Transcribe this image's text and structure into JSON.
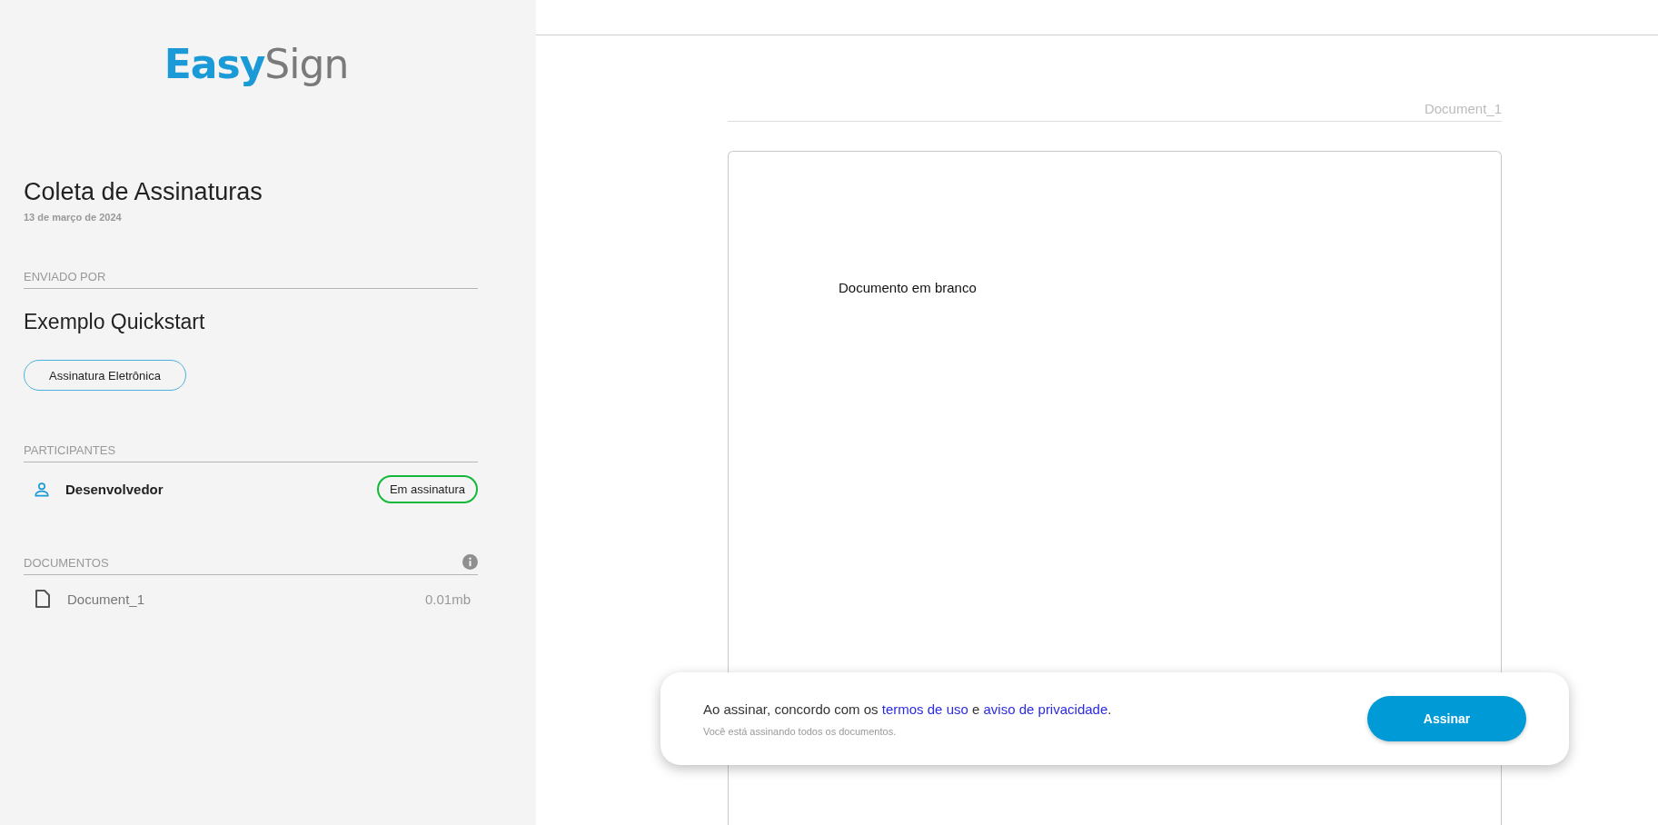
{
  "logo": "**Easy**Sign",
  "envelope": {
    "title": "Coleta de Assinaturas",
    "date": "13 de março de 2024"
  },
  "sender": {
    "heading": "ENVIADO POR",
    "name": "Exemplo Quickstart",
    "signature_type": "Assinatura Eletrônica"
  },
  "participants": {
    "heading": "PARTICIPANTES",
    "items": [
      {
        "name": "Desenvolvedor",
        "status": "Em assinatura"
      }
    ]
  },
  "documents": {
    "heading": "DOCUMENTOS",
    "items": [
      {
        "name": "Document_1",
        "size": "0.01mb"
      }
    ]
  },
  "viewer": {
    "document_title": "Document_1",
    "page_text": "Documento em branco"
  },
  "consent": {
    "segments": [
      {
        "kind": "text",
        "text": "Ao assinar, concordo com os "
      },
      {
        "kind": "link",
        "text": "termos de uso"
      },
      {
        "kind": "text",
        "text": " e "
      },
      {
        "kind": "link",
        "text": "aviso de privacidade"
      },
      {
        "kind": "text",
        "text": "."
      }
    ],
    "note": "Você está assinando todos os documentos.",
    "button": "Assinar"
  }
}
